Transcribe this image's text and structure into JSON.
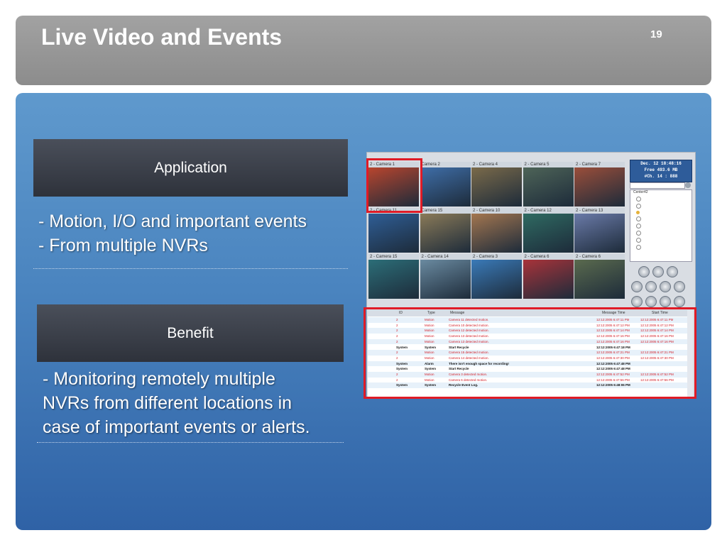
{
  "slide": {
    "title": "Live Video and Events",
    "page_number": "19"
  },
  "application": {
    "heading": "Application",
    "lines": [
      "- Motion, I/O and important events",
      "- From multiple NVRs"
    ]
  },
  "benefit": {
    "heading": "Benefit",
    "lines": [
      "- Monitoring remotely multiple",
      "NVRs from different locations in",
      "case of important events or alerts."
    ]
  },
  "screenshot": {
    "clock_lines": [
      "Dec. 12 18:48:16",
      "Free 493.6 MB",
      "#Ch. 14 : 888"
    ],
    "tree_root": "Center42",
    "cameras": [
      {
        "label": "2 - Camera 1",
        "color": "#b8452e"
      },
      {
        "label": "Camera 2",
        "color": "#3f6ea8"
      },
      {
        "label": "2 - Camera 4",
        "color": "#7a6a4a"
      },
      {
        "label": "2 - Camera 5",
        "color": "#4e6458"
      },
      {
        "label": "2 - Camera 7",
        "color": "#9a4e3a"
      },
      {
        "label": "2 - Camera 11",
        "color": "#2f5e96"
      },
      {
        "label": "Camera 15",
        "color": "#8a7a58"
      },
      {
        "label": "2 - Camera 10",
        "color": "#a37650"
      },
      {
        "label": "2 - Camera 12",
        "color": "#2f6a62"
      },
      {
        "label": "2 - Camera 13",
        "color": "#6a7aa8"
      },
      {
        "label": "2 - Camera 15",
        "color": "#2c6e78"
      },
      {
        "label": "2 - Camera 14",
        "color": "#6a8aa0"
      },
      {
        "label": "2 - Camera 3",
        "color": "#3a7ab8"
      },
      {
        "label": "2 - Camera 6",
        "color": "#a8333a"
      },
      {
        "label": "2 - Camera 6",
        "color": "#5a6a4e"
      }
    ],
    "event_columns": [
      "ID",
      "Type",
      "Message",
      "Message Time",
      "Start Time"
    ],
    "events": [
      {
        "id": "2",
        "type": "Motion",
        "message": "Camera 11 detected motion.",
        "msg_time": "12:12:2005 6:47:11 PM",
        "start_time": "12:12:2005 6:47:11 PM",
        "red": true
      },
      {
        "id": "2",
        "type": "Motion",
        "message": "Camera 10 detected motion.",
        "msg_time": "12:12:2005 6:47:12 PM",
        "start_time": "12:12:2005 6:47:12 PM",
        "red": true
      },
      {
        "id": "2",
        "type": "Motion",
        "message": "Camera 12 detected motion.",
        "msg_time": "12:12:2005 6:47:14 PM",
        "start_time": "12:12:2005 6:47:14 PM",
        "red": true
      },
      {
        "id": "2",
        "type": "Motion",
        "message": "Camera 13 detected motion.",
        "msg_time": "12:12:2005 6:47:16 PM",
        "start_time": "12:12:2005 6:47:16 PM",
        "red": true
      },
      {
        "id": "2",
        "type": "Motion",
        "message": "Camera 13 detected motion.",
        "msg_time": "12:12:2005 6:47:16 PM",
        "start_time": "12:12:2005 6:47:16 PM",
        "red": true
      },
      {
        "id": "System",
        "type": "System",
        "message": "Start Recycle",
        "msg_time": "12:12:2005 6:47:18 PM",
        "start_time": "",
        "red": false
      },
      {
        "id": "2",
        "type": "Motion",
        "message": "Camera 15 detected motion.",
        "msg_time": "12:12:2005 6:47:21 PM",
        "start_time": "12:12:2005 6:47:21 PM",
        "red": true
      },
      {
        "id": "2",
        "type": "Motion",
        "message": "Camera 14 detected motion.",
        "msg_time": "12:12:2005 6:47:30 PM",
        "start_time": "12:12:2005 6:47:30 PM",
        "red": true
      },
      {
        "id": "System",
        "type": "Alarm",
        "message": "There isn't enough space for recording!",
        "msg_time": "12:12:2005 6:47:48 PM",
        "start_time": "",
        "red": false
      },
      {
        "id": "System",
        "type": "System",
        "message": "Start Recycle",
        "msg_time": "12:12:2005 6:47:48 PM",
        "start_time": "",
        "red": false
      },
      {
        "id": "2",
        "type": "Motion",
        "message": "Camera 3 detected motion.",
        "msg_time": "12:12:2005 6:47:52 PM",
        "start_time": "12:12:2005 6:47:52 PM",
        "red": true
      },
      {
        "id": "2",
        "type": "Motion",
        "message": "Camera 6 detected motion.",
        "msg_time": "12:12:2005 6:47:56 PM",
        "start_time": "12:12:2005 6:47:56 PM",
        "red": true
      },
      {
        "id": "System",
        "type": "System",
        "message": "Recycle Event Log.",
        "msg_time": "12:12:2005 6:48:06 PM",
        "start_time": "",
        "red": false
      }
    ]
  }
}
